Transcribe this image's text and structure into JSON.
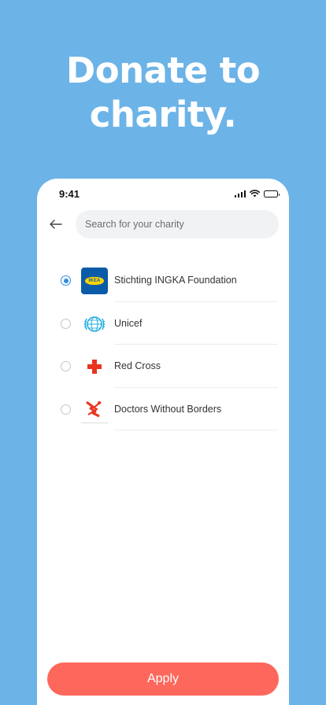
{
  "headline": {
    "line1": "Donate to",
    "line2": "charity."
  },
  "status_bar": {
    "time": "9:41",
    "icons": [
      "signal-icon",
      "wifi-icon",
      "battery-icon"
    ]
  },
  "search": {
    "placeholder": "Search for your charity",
    "value": ""
  },
  "charities": [
    {
      "name": "Stichting INGKA Foundation",
      "logo": "ikea-logo",
      "logo_text": "IKEA",
      "selected": true
    },
    {
      "name": "Unicef",
      "logo": "unicef-logo",
      "selected": false
    },
    {
      "name": "Red Cross",
      "logo": "red-cross-logo",
      "selected": false
    },
    {
      "name": "Doctors Without Borders",
      "logo": "msf-logo",
      "selected": false
    }
  ],
  "apply_label": "Apply",
  "colors": {
    "background": "#6cb3e7",
    "accent": "#2f8de4",
    "apply_button": "#fd675c",
    "red_cross": "#e8351f"
  }
}
